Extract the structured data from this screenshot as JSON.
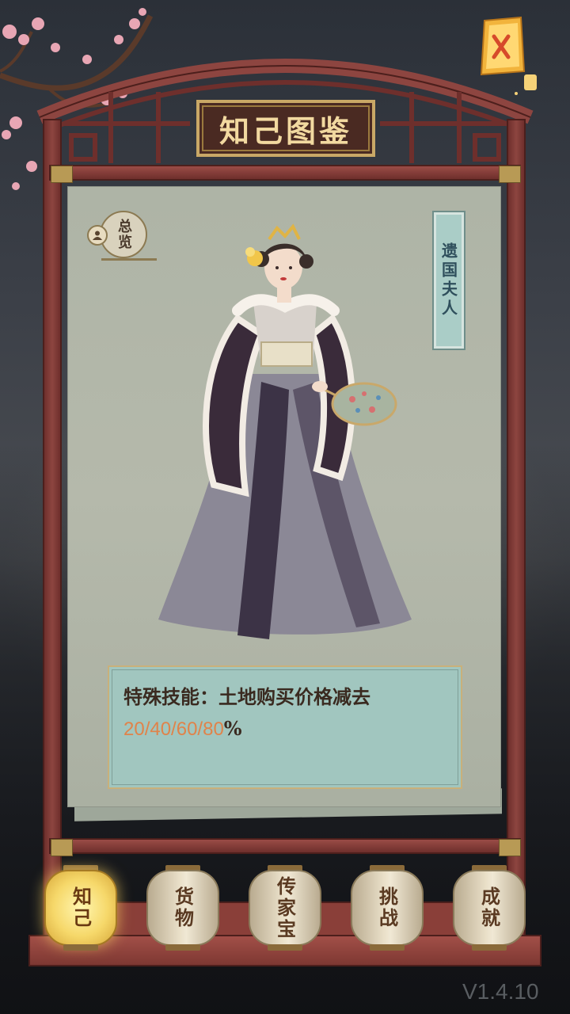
{
  "title": "知己图鉴",
  "overview_label": "总览",
  "character_name": "遗国夫人",
  "skill": {
    "label": "特殊技能：",
    "text": "土地购买价格减去",
    "values": "20/40/60/80",
    "unit": "%"
  },
  "tabs": [
    {
      "label": "知己",
      "active": true
    },
    {
      "label": "货物",
      "active": false
    },
    {
      "label": "传家宝",
      "active": false
    },
    {
      "label": "挑战",
      "active": false
    },
    {
      "label": "成就",
      "active": false
    }
  ],
  "version": "V1.4.10",
  "colors": {
    "frame": "#8d4540",
    "paper": "#b5b9ab",
    "skill_box": "#a1c6bf",
    "highlight_number": "#e0834a",
    "active_lantern": "#f6d86a"
  },
  "icons": {
    "close": "lantern-close-icon",
    "overview": "person-icon"
  }
}
